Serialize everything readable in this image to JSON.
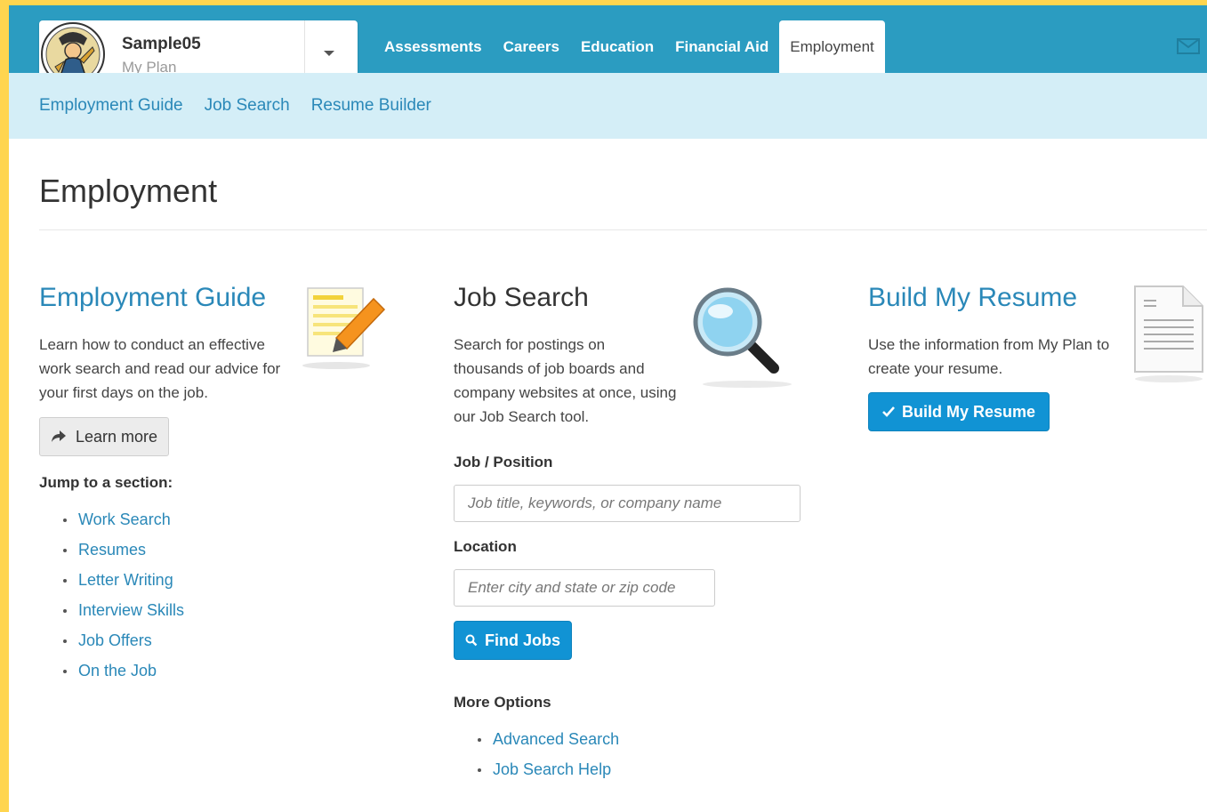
{
  "profile": {
    "name": "Sample05",
    "subtitle": "My Plan"
  },
  "main_nav": [
    "Assessments",
    "Careers",
    "Education",
    "Financial Aid",
    "Employment"
  ],
  "sub_nav": [
    "Employment Guide",
    "Job Search",
    "Resume Builder"
  ],
  "page_title": "Employment",
  "guide": {
    "title": "Employment Guide",
    "description_lines": [
      "Learn how to conduct an effective",
      "work search and read our advice for",
      "your first days on the job."
    ],
    "learn_more": "Learn more",
    "jump_label": "Jump to a section:",
    "sections": [
      "Work Search",
      "Resumes",
      "Letter Writing",
      "Interview Skills",
      "Job Offers",
      "On the Job"
    ]
  },
  "job_search": {
    "title": "Job Search",
    "description_lines": [
      "Search for postings on",
      "thousands of job boards and",
      "company websites at once, using",
      "our Job Search tool."
    ],
    "job_label": "Job / Position",
    "job_placeholder": "Job title, keywords, or company name",
    "location_label": "Location",
    "location_placeholder": "Enter city and state or zip code",
    "find_button": "Find Jobs",
    "more_label": "More Options",
    "more_links": [
      "Advanced Search",
      "Job Search Help"
    ]
  },
  "resume": {
    "title": "Build My Resume",
    "description_lines": [
      "Use the information from My Plan to",
      "create your resume."
    ],
    "button": "Build My Resume"
  },
  "colors": {
    "topbar": "#2b9cc1",
    "subnav": "#d4eef7",
    "link": "#2a88b8",
    "primary": "#1193d4",
    "page_border": "#ffd54f"
  }
}
